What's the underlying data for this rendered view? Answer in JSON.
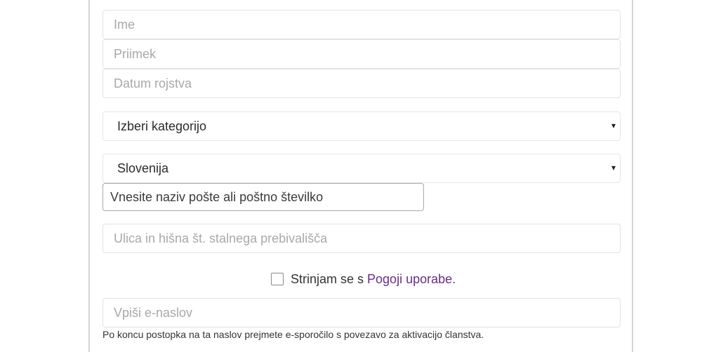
{
  "form": {
    "first_name": {
      "placeholder": "Ime",
      "value": ""
    },
    "last_name": {
      "placeholder": "Priimek",
      "value": ""
    },
    "birth_date": {
      "placeholder": "Datum rojstva",
      "value": ""
    },
    "category_select": {
      "selected": "Izberi kategorijo"
    },
    "country_select": {
      "selected": "Slovenija"
    },
    "post_office": {
      "placeholder": "Vnesite naziv pošte ali poštno številko",
      "value": ""
    },
    "street_address": {
      "placeholder": "Ulica in hišna št. stalnega prebivališča",
      "value": ""
    },
    "terms": {
      "checked": false,
      "label_prefix": "Strinjam se s",
      "link_text": "Pogoji uporabe."
    },
    "email": {
      "placeholder": "Vpiši e-naslov",
      "value": ""
    },
    "email_help": "Po koncu postopka na ta naslov prejmete e-sporočilo s povezavo za aktivacijo članstva."
  },
  "icons": {
    "caret": "▾"
  },
  "colors": {
    "link": "#6a2b8c",
    "placeholder": "#a8a8a8",
    "border": "#e2e2e2"
  }
}
